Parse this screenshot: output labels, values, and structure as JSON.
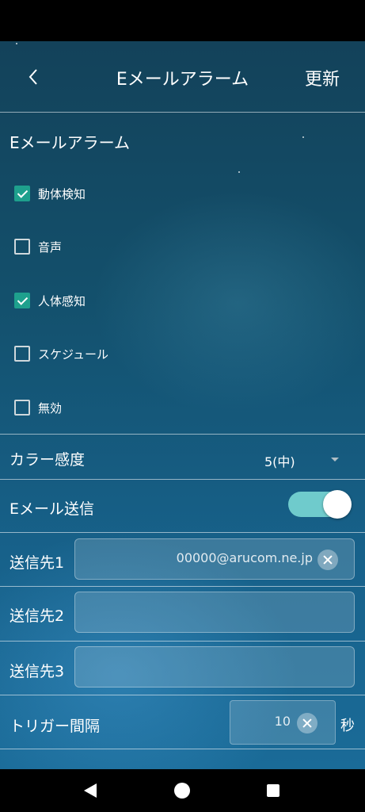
{
  "header": {
    "title": "Eメールアラーム",
    "refresh_label": "更新"
  },
  "alarm": {
    "section_title": "Eメールアラーム",
    "options": [
      {
        "label": "動体検知",
        "checked": true
      },
      {
        "label": "音声",
        "checked": false
      },
      {
        "label": "人体感知",
        "checked": true
      },
      {
        "label": "スケジュール",
        "checked": false
      },
      {
        "label": "無効",
        "checked": false
      }
    ]
  },
  "color_sensitivity": {
    "label": "カラー感度",
    "value": "5(中)"
  },
  "email_send": {
    "label": "Eメール送信",
    "enabled": true
  },
  "recipients": [
    {
      "label": "送信先1",
      "value": "00000@arucom.ne.jp"
    },
    {
      "label": "送信先2",
      "value": ""
    },
    {
      "label": "送信先3",
      "value": ""
    }
  ],
  "trigger": {
    "label": "トリガー間隔",
    "value": "10",
    "unit": "秒"
  },
  "colors": {
    "accent": "#1ea08d",
    "toggle_track": "#6fcbcc"
  }
}
